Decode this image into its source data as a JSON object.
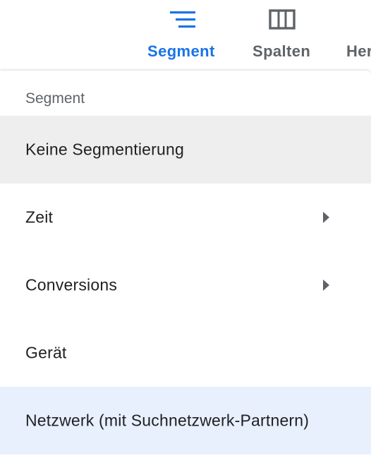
{
  "toolbar": {
    "segment_label": "Segment",
    "spalten_label": "Spalten",
    "more_label": "Her",
    "icons": {
      "segment": "segment-icon",
      "spalten": "columns-icon"
    },
    "active_color": "#1a73e8",
    "inactive_color": "#5f6368"
  },
  "menu": {
    "heading": "Segment",
    "items": [
      {
        "label": "Keine Segmentierung",
        "has_submenu": false,
        "state": "hovered"
      },
      {
        "label": "Zeit",
        "has_submenu": true,
        "state": "normal"
      },
      {
        "label": "Conversions",
        "has_submenu": true,
        "state": "normal"
      },
      {
        "label": "Gerät",
        "has_submenu": false,
        "state": "normal"
      },
      {
        "label": "Netzwerk (mit Suchnetzwerk-Partnern)",
        "has_submenu": false,
        "state": "selected"
      }
    ],
    "colors": {
      "hover_bg": "#eeeeee",
      "selected_bg": "#e8f0fe",
      "text": "#202124",
      "heading": "#5f6368",
      "arrow": "#5f6368"
    }
  }
}
